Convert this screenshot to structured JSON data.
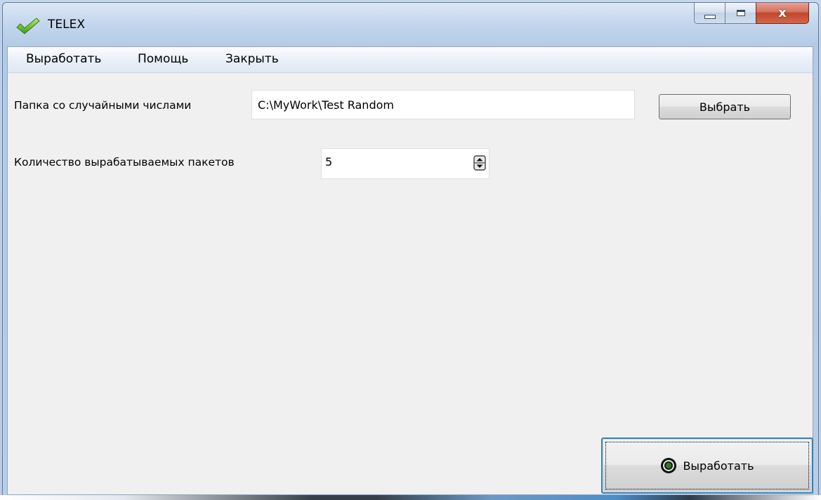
{
  "window": {
    "title": "TELEX",
    "close_glyph": "x",
    "icon": "checkmark-icon"
  },
  "menu": {
    "items": [
      "Выработать",
      "Помощь",
      "Закрыть"
    ]
  },
  "folder": {
    "label": "Папка со случайными числами",
    "value": "C:\\MyWork\\Test Random",
    "browse_label": "Выбрать"
  },
  "packets": {
    "label": "Количество вырабатываемых пакетов",
    "value": "5"
  },
  "generate_button": {
    "label": "Выработать",
    "icon": "record-icon"
  },
  "colors": {
    "client_bg": "#f0f0f0",
    "close_button": "#c3452a",
    "focus_border": "#3c7fb1"
  }
}
